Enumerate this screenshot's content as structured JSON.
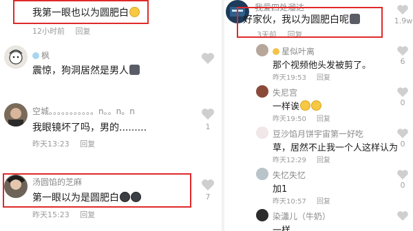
{
  "left": {
    "comments": [
      {
        "username": "",
        "text": "我第一眼也以为圆肥白",
        "time": "12小时前",
        "reply": "回复",
        "likes": ""
      },
      {
        "username": "枫",
        "text": "震惊，狗洞居然是男人",
        "time": "",
        "reply": "",
        "likes": ""
      },
      {
        "username": "空城。。。。。。。。。。。n。。n。n",
        "text": "我眼镜坏了吗，男的.........",
        "time": "昨天13:23",
        "reply": "回复",
        "likes": "1"
      },
      {
        "username": "汤圆馅的芝麻",
        "text": "第一眼以为是圆肥白",
        "time": "昨天15:23",
        "reply": "回复",
        "likes": "7"
      }
    ]
  },
  "right": {
    "top_comment": {
      "username": "我爱四处溜达",
      "text": "好家伙，我以为圆肥白呢",
      "time": "3天前",
      "reply": "回复",
      "likes": "1.9w"
    },
    "replies": [
      {
        "username": "星似叶离",
        "text": "那个视频他头发被剪了。",
        "time": "昨天19:53",
        "reply": "回复",
        "likes": "6"
      },
      {
        "username": "失尼宫",
        "text": "一样诶",
        "time": "昨天19:50",
        "reply": "回复",
        "likes": "0"
      },
      {
        "username": "豆沙馅月饼宇宙第一好吃",
        "text": "草，居然不止我一个人这样认为",
        "time": "昨天12:29",
        "reply": "回复",
        "likes": "0"
      },
      {
        "username": "失忆失忆",
        "text": "加1",
        "time": "昨天10:57",
        "reply": "回复",
        "likes": "0"
      },
      {
        "username": "染瀟儿（牛奶）",
        "text": "一样",
        "time": "",
        "reply": "",
        "likes": ""
      }
    ]
  },
  "colors": {
    "highlight_box": "#e02828",
    "heart": "#cfcfcf",
    "meta_text": "#9a9a9a"
  }
}
